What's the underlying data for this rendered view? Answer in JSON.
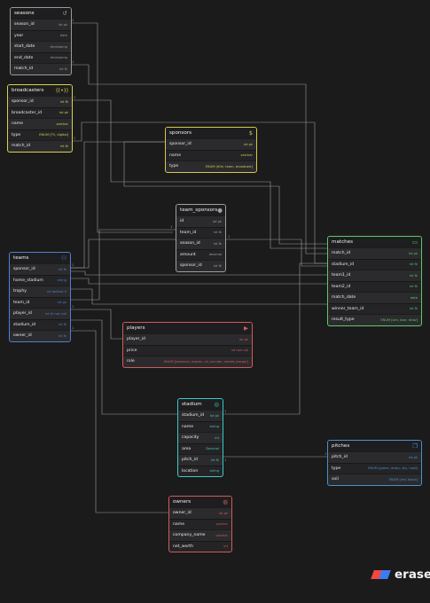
{
  "tables": [
    {
      "id": "seasons",
      "title": "seasons",
      "icon": "history-icon",
      "glyph": "↺",
      "color": "#9a9a9a",
      "fields": [
        [
          "season_id",
          "int pk"
        ],
        [
          "year",
          "date"
        ],
        [
          "start_date",
          "timestamp"
        ],
        [
          "end_date",
          "timestamp"
        ],
        [
          "match_id",
          "int fk"
        ]
      ]
    },
    {
      "id": "broadcasters",
      "title": "broadcasters",
      "icon": "broadcast-icon",
      "glyph": "((•))",
      "color": "#d6d24a",
      "fields": [
        [
          "sponsor_id",
          "int fk"
        ],
        [
          "broadcaster_id",
          "int pk"
        ],
        [
          "name",
          "varchar"
        ],
        [
          "type",
          "ENUM [TV, digital]"
        ],
        [
          "match_id",
          "int fk"
        ]
      ]
    },
    {
      "id": "sponsors",
      "title": "sponsors",
      "icon": "dollar-icon",
      "glyph": "$",
      "color": "#d6c84a",
      "fields": [
        [
          "sponsor_id",
          "int pk"
        ],
        [
          "name",
          "varchar"
        ],
        [
          "type",
          "ENUM [title, team, broadcast]"
        ]
      ]
    },
    {
      "id": "team_sponsors",
      "title": "team_sponsors",
      "icon": "circle-dot-icon",
      "glyph": "●",
      "color": "#a0a0a0",
      "fields": [
        [
          "id",
          "int pk"
        ],
        [
          "team_id",
          "int fk"
        ],
        [
          "season_id",
          "int fk"
        ],
        [
          "amount",
          "decimal"
        ],
        [
          "sponsor_id",
          "int fk"
        ]
      ]
    },
    {
      "id": "teams",
      "title": "teams",
      "icon": "users-icon",
      "glyph": "⚇",
      "color": "#4f7fd0",
      "fields": [
        [
          "sponsor_id",
          "int fk"
        ],
        [
          "home_stadium",
          "string"
        ],
        [
          "trophy",
          "int default 0"
        ],
        [
          "team_id",
          "int pk"
        ],
        [
          "player_id",
          "int fk not null"
        ],
        [
          "stadium_id",
          "int fk"
        ],
        [
          "owner_id",
          "int fk"
        ]
      ]
    },
    {
      "id": "matches",
      "title": "matches",
      "icon": "gamepad-icon",
      "glyph": "▭",
      "color": "#5fc76a",
      "fields": [
        [
          "match_id",
          "int pk"
        ],
        [
          "stadium_id",
          "int fk"
        ],
        [
          "team1_id",
          "int fk"
        ],
        [
          "team2_id",
          "int fk"
        ],
        [
          "match_date",
          "date"
        ],
        [
          "winner_team_id",
          "int fk"
        ],
        [
          "result_type",
          "ENUM [win, lose, draw]"
        ]
      ]
    },
    {
      "id": "players",
      "title": "players",
      "icon": "play-icon",
      "glyph": "▶",
      "color": "#d25a5a",
      "fields": [
        [
          "player_id",
          "int pk"
        ],
        [
          "price",
          "int not null"
        ],
        [
          "role",
          "ENUM [batsman, bowler, all_rounder, wicket_keeper]"
        ]
      ]
    },
    {
      "id": "stadium",
      "title": "stadium",
      "icon": "stadium-icon",
      "glyph": "◎",
      "color": "#3fc9c4",
      "fields": [
        [
          "stadium_id",
          "int pk"
        ],
        [
          "name",
          "string"
        ],
        [
          "capacity",
          "int"
        ],
        [
          "area",
          "Decimal"
        ],
        [
          "pitch_id",
          "int fk"
        ],
        [
          "location",
          "string"
        ]
      ]
    },
    {
      "id": "pitches",
      "title": "pitches",
      "icon": "copy-icon",
      "glyph": "❐",
      "color": "#4a90c8",
      "fields": [
        [
          "pitch_id",
          "int pk"
        ],
        [
          "type",
          "ENUM [green, dusty, dry, hard]"
        ],
        [
          "soil",
          "ENUM [red, black]"
        ]
      ]
    },
    {
      "id": "owners",
      "title": "owners",
      "icon": "owner-icon",
      "glyph": "◍",
      "color": "#d25a5a",
      "fields": [
        [
          "owner_id",
          "int pk"
        ],
        [
          "name",
          "varchar"
        ],
        [
          "company_name",
          "varchar"
        ],
        [
          "net_worth",
          "int"
        ]
      ]
    }
  ],
  "markers": [
    "1",
    "1",
    "1",
    "1",
    "1",
    "1",
    "1",
    "1",
    "1",
    "1",
    "1",
    "1"
  ],
  "brand": {
    "name": "eraser",
    "colors": [
      "#3b7bf5",
      "#f2473f"
    ]
  }
}
